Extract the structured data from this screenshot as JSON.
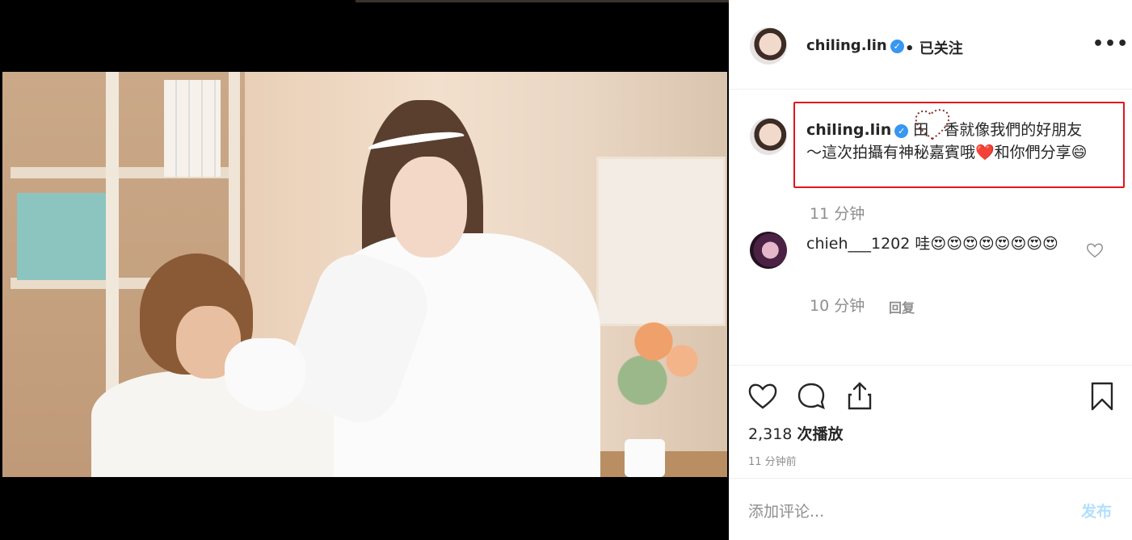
{
  "post": {
    "username": "chiling.lin",
    "verified_mark": "✓",
    "follow_state": "• 已关注",
    "more_icon": "•••"
  },
  "caption": {
    "username": "chiling.lin",
    "text": "田　香就像我們的好朋友～這次拍攝有神秘嘉賓哦❤️和你們分享😄",
    "time": "11 分钟"
  },
  "comments": [
    {
      "username": "chieh___1202",
      "text": "哇😍😍😍😍😍😍😍😍",
      "time": "10 分钟",
      "reply_label": "回复"
    }
  ],
  "stats": {
    "views_count": "2,318",
    "views_label": "次播放",
    "posted_ago": "11 分钟前"
  },
  "comment_box": {
    "placeholder": "添加评论...",
    "post_label": "发布"
  },
  "icons": {
    "like": "heart-icon",
    "comment": "comment-icon",
    "share": "share-icon",
    "save": "bookmark-icon"
  },
  "colors": {
    "verified_blue": "#3897f0",
    "highlight_red": "#e0161d",
    "post_button_disabled": "#b2dffc",
    "secondary_text": "#8e8e8e"
  }
}
